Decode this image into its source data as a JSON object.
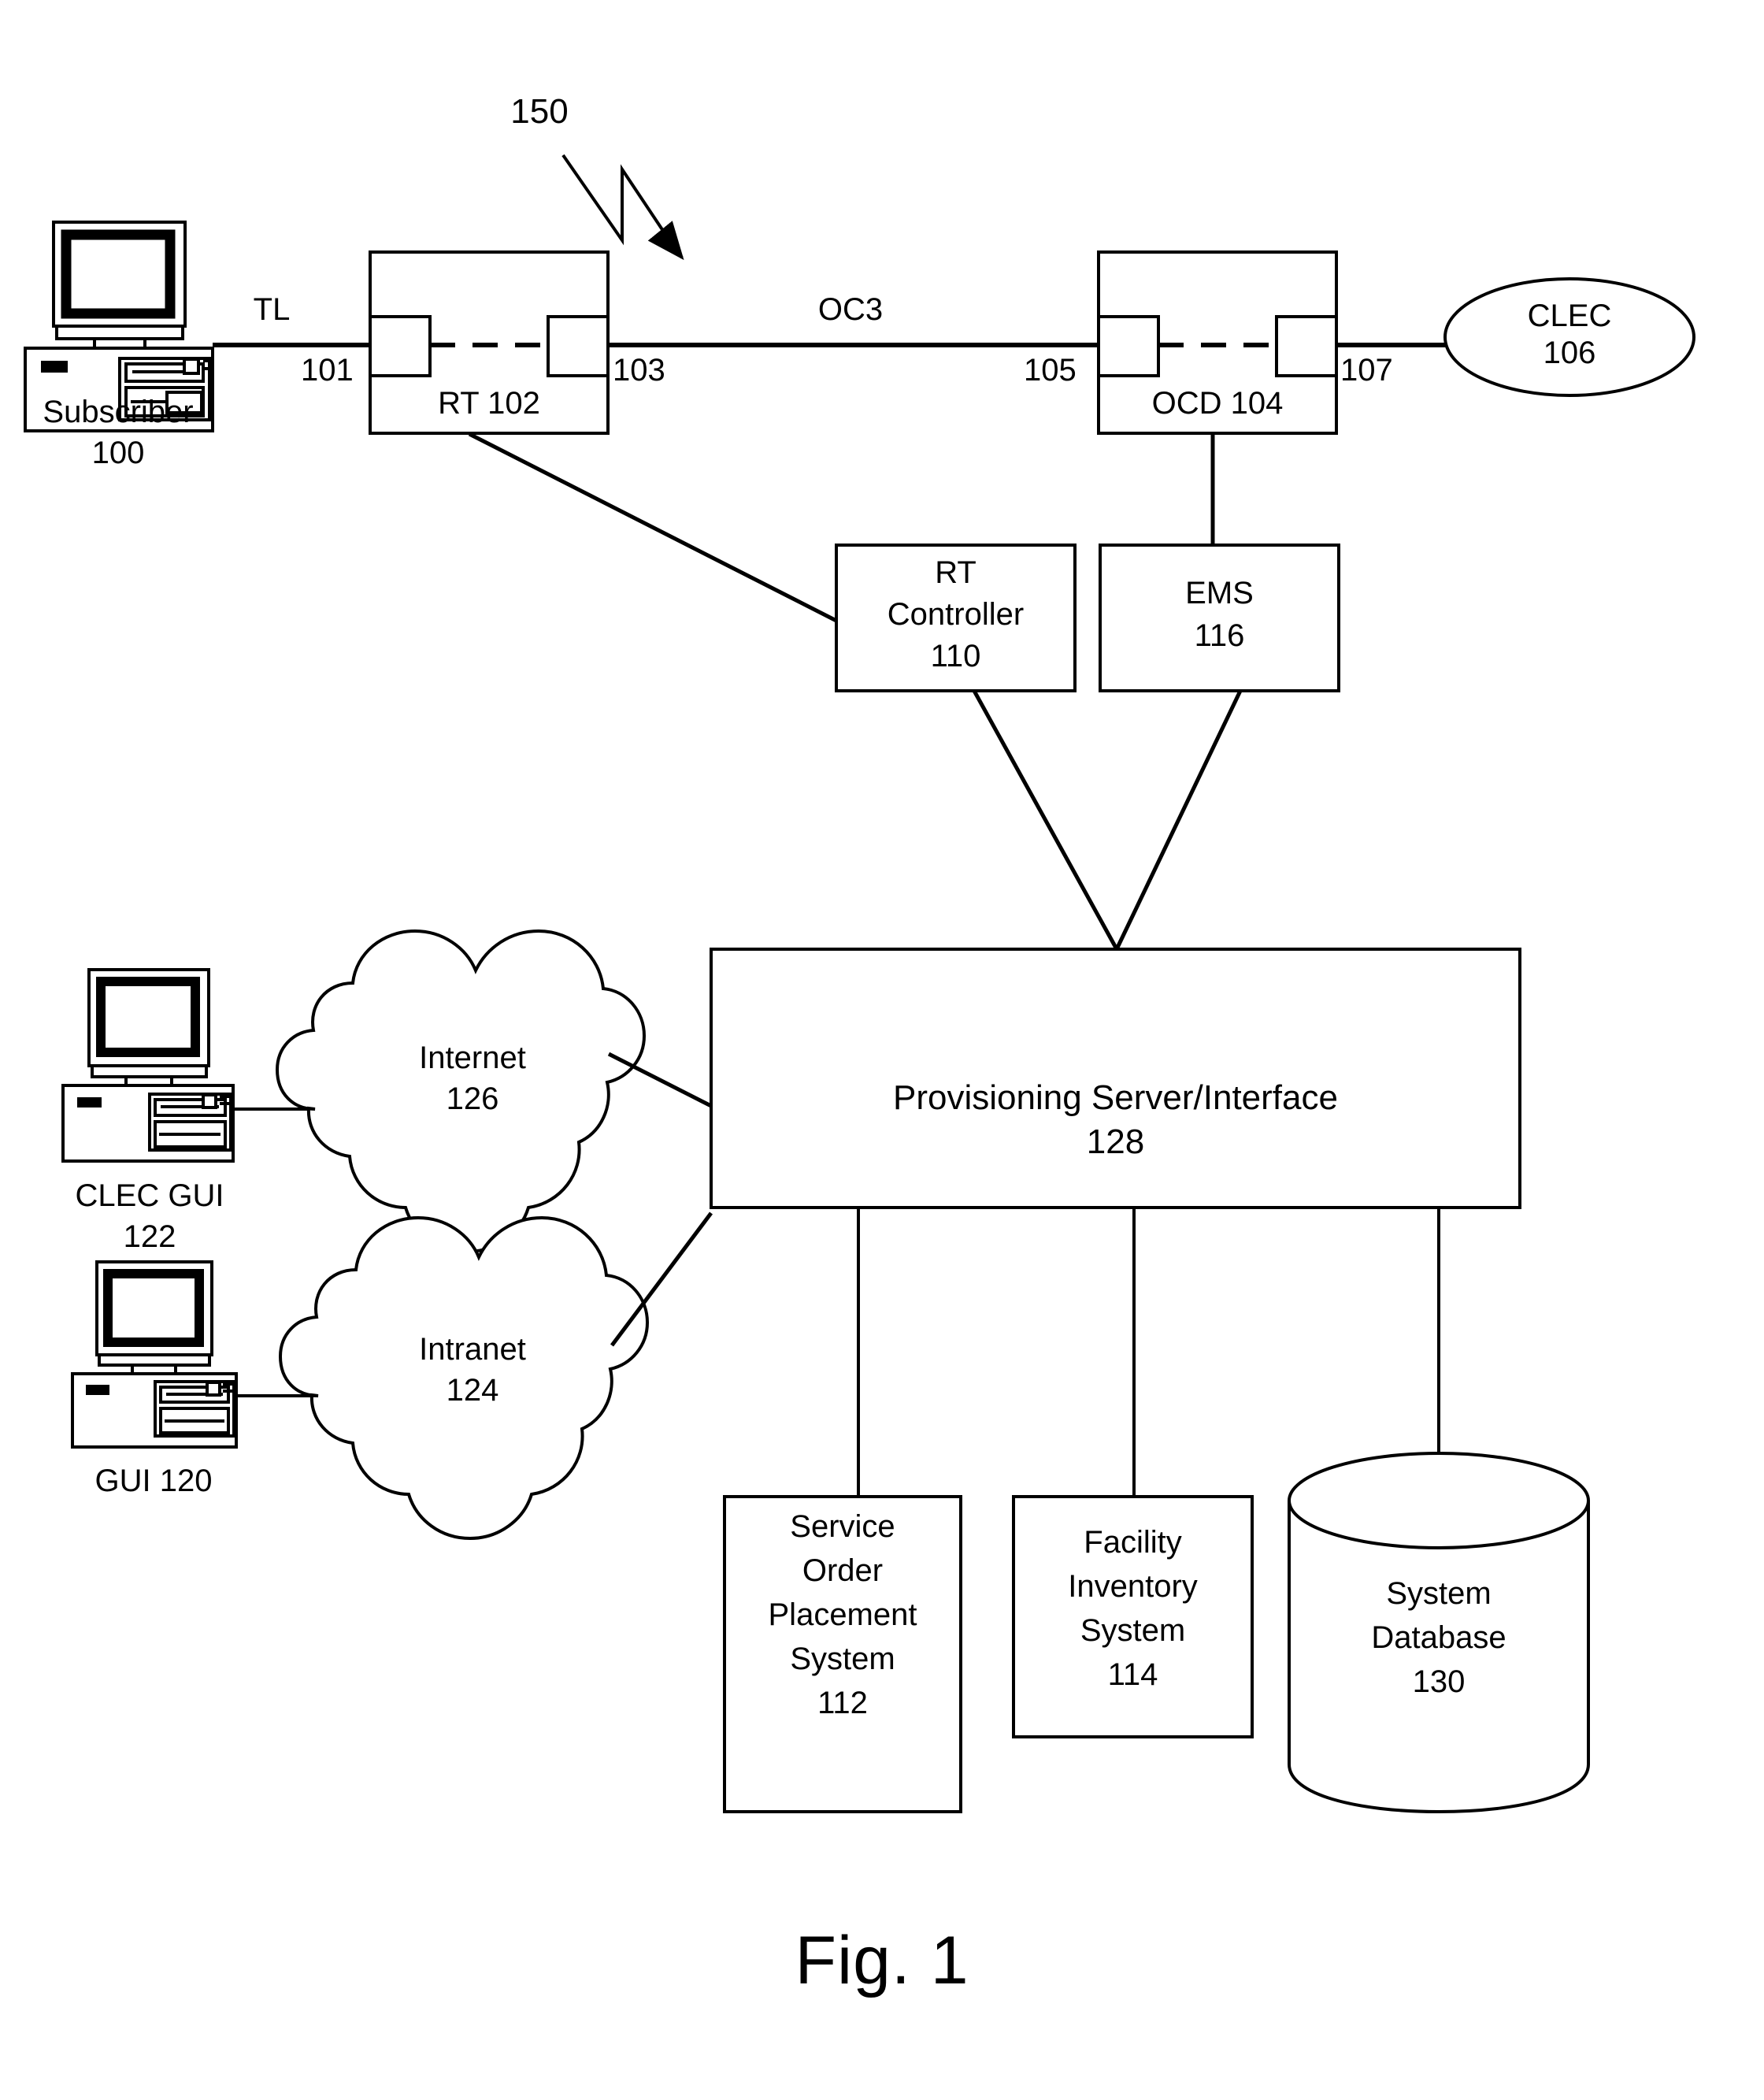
{
  "figure": {
    "caption": "Fig. 1",
    "system_ref": "150"
  },
  "nodes": {
    "subscriber": {
      "label": "Subscriber",
      "ref": "100",
      "icon": "desktop-computer-icon"
    },
    "rt": {
      "label": "RT 102",
      "port_left_ref": "101",
      "port_right_ref": "103"
    },
    "ocd": {
      "label": "OCD 104",
      "port_left_ref": "105",
      "port_right_ref": "107"
    },
    "clec": {
      "label": "CLEC",
      "ref": "106"
    },
    "rt_controller": {
      "line1": "RT",
      "line2": "Controller",
      "ref": "110"
    },
    "ems": {
      "label": "EMS",
      "ref": "116"
    },
    "clec_gui": {
      "line1": "CLEC GUI",
      "ref": "122",
      "icon": "desktop-computer-icon"
    },
    "gui": {
      "label": "GUI 120",
      "icon": "desktop-computer-icon"
    },
    "internet": {
      "label": "Internet",
      "ref": "126"
    },
    "intranet": {
      "label": "Intranet",
      "ref": "124"
    },
    "provisioning_server": {
      "label": "Provisioning Server/Interface",
      "ref": "128"
    },
    "service_order": {
      "line1": "Service",
      "line2": "Order",
      "line3": "Placement",
      "line4": "System",
      "ref": "112"
    },
    "facility_inventory": {
      "line1": "Facility",
      "line2": "Inventory",
      "line3": "System",
      "ref": "114"
    },
    "system_database": {
      "line1": "System",
      "line2": "Database",
      "ref": "130"
    }
  },
  "links": {
    "subscriber_to_rt": "TL",
    "rt_to_ocd": "OC3"
  }
}
